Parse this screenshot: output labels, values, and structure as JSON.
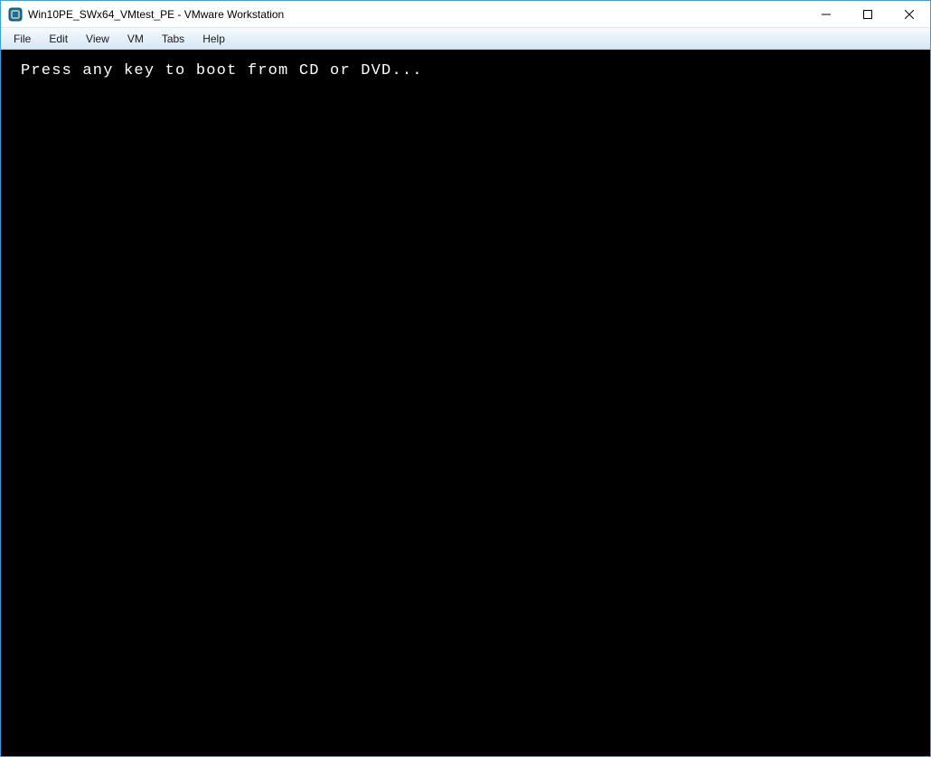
{
  "titlebar": {
    "title": "Win10PE_SWx64_VMtest_PE - VMware Workstation"
  },
  "menubar": {
    "items": [
      {
        "label": "File"
      },
      {
        "label": "Edit"
      },
      {
        "label": "View"
      },
      {
        "label": "VM"
      },
      {
        "label": "Tabs"
      },
      {
        "label": "Help"
      }
    ]
  },
  "vm": {
    "boot_prompt": "Press any key to boot from CD or DVD..."
  }
}
